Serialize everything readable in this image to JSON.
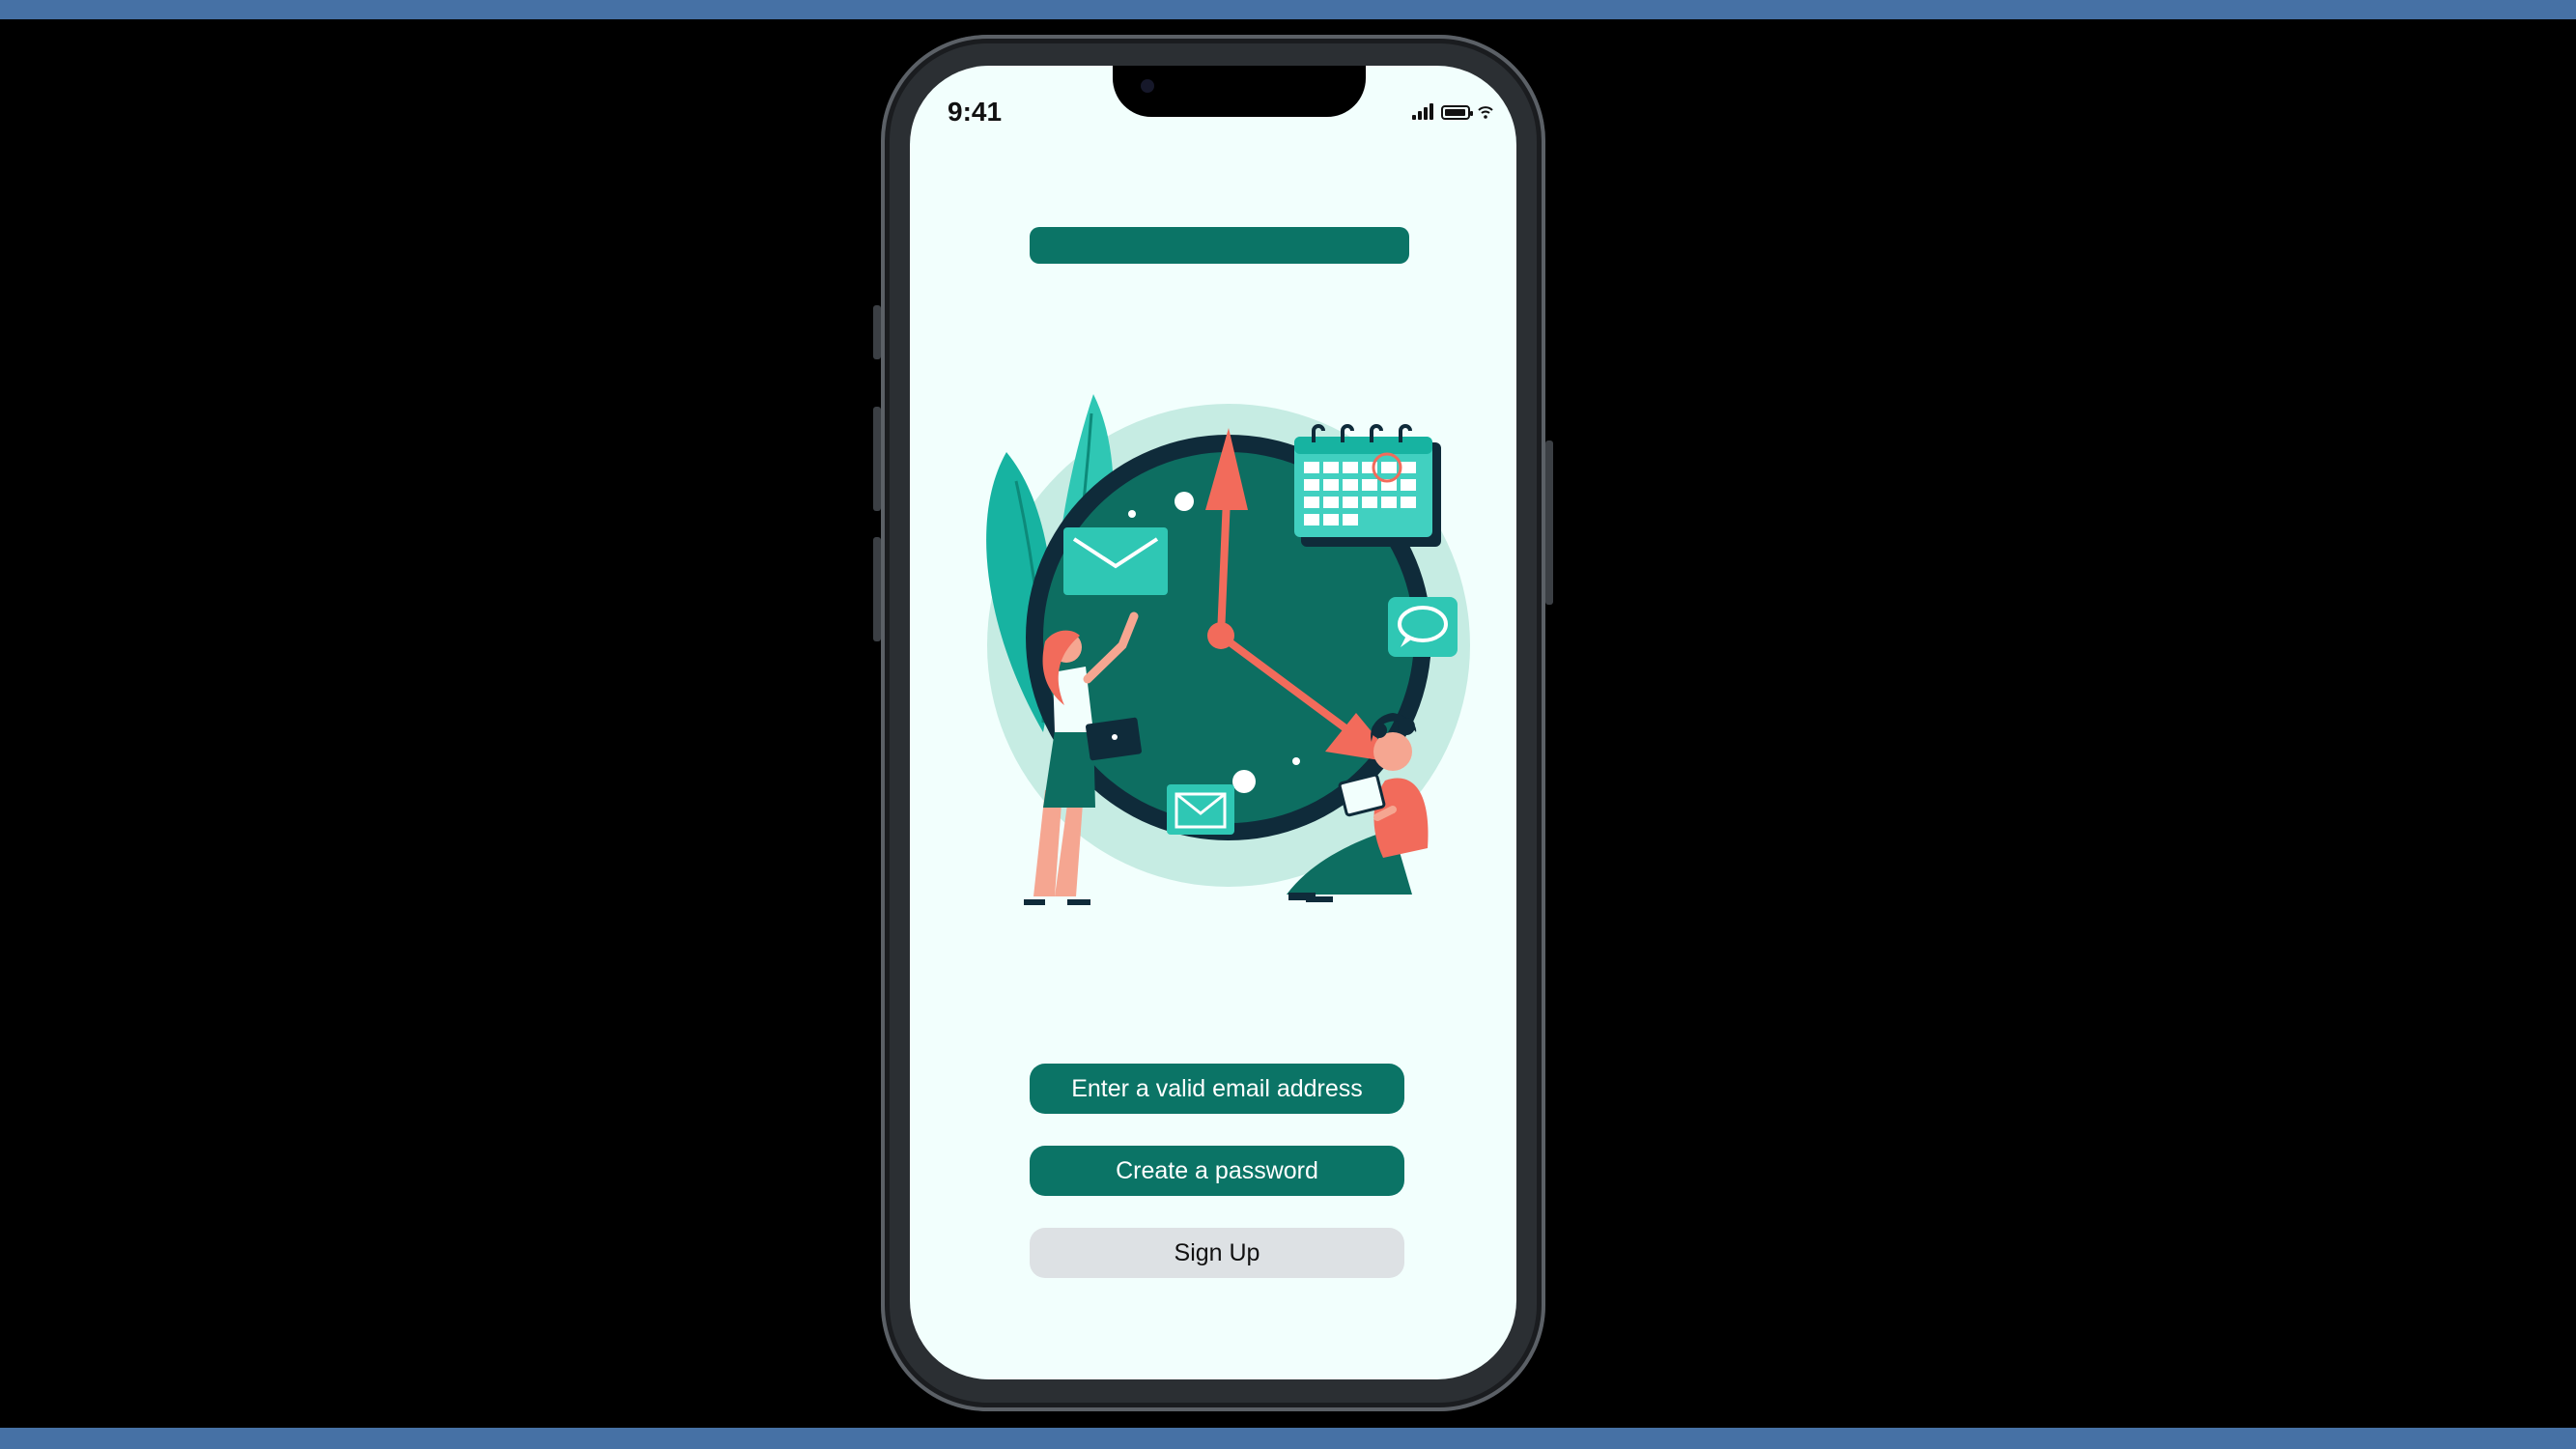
{
  "status_bar": {
    "time": "9:41"
  },
  "colors": {
    "frame": "#4671a5",
    "screen_background": "#f2fffd",
    "primary": "#0b7466",
    "secondary_button": "#dde1e4",
    "accent": "#f26b5b"
  },
  "illustration": {
    "description_icon": "clock-team-illustration-icon"
  },
  "form": {
    "email_button_label": "Enter a valid email address",
    "password_button_label": "Create a password",
    "signup_button_label": "Sign Up"
  }
}
